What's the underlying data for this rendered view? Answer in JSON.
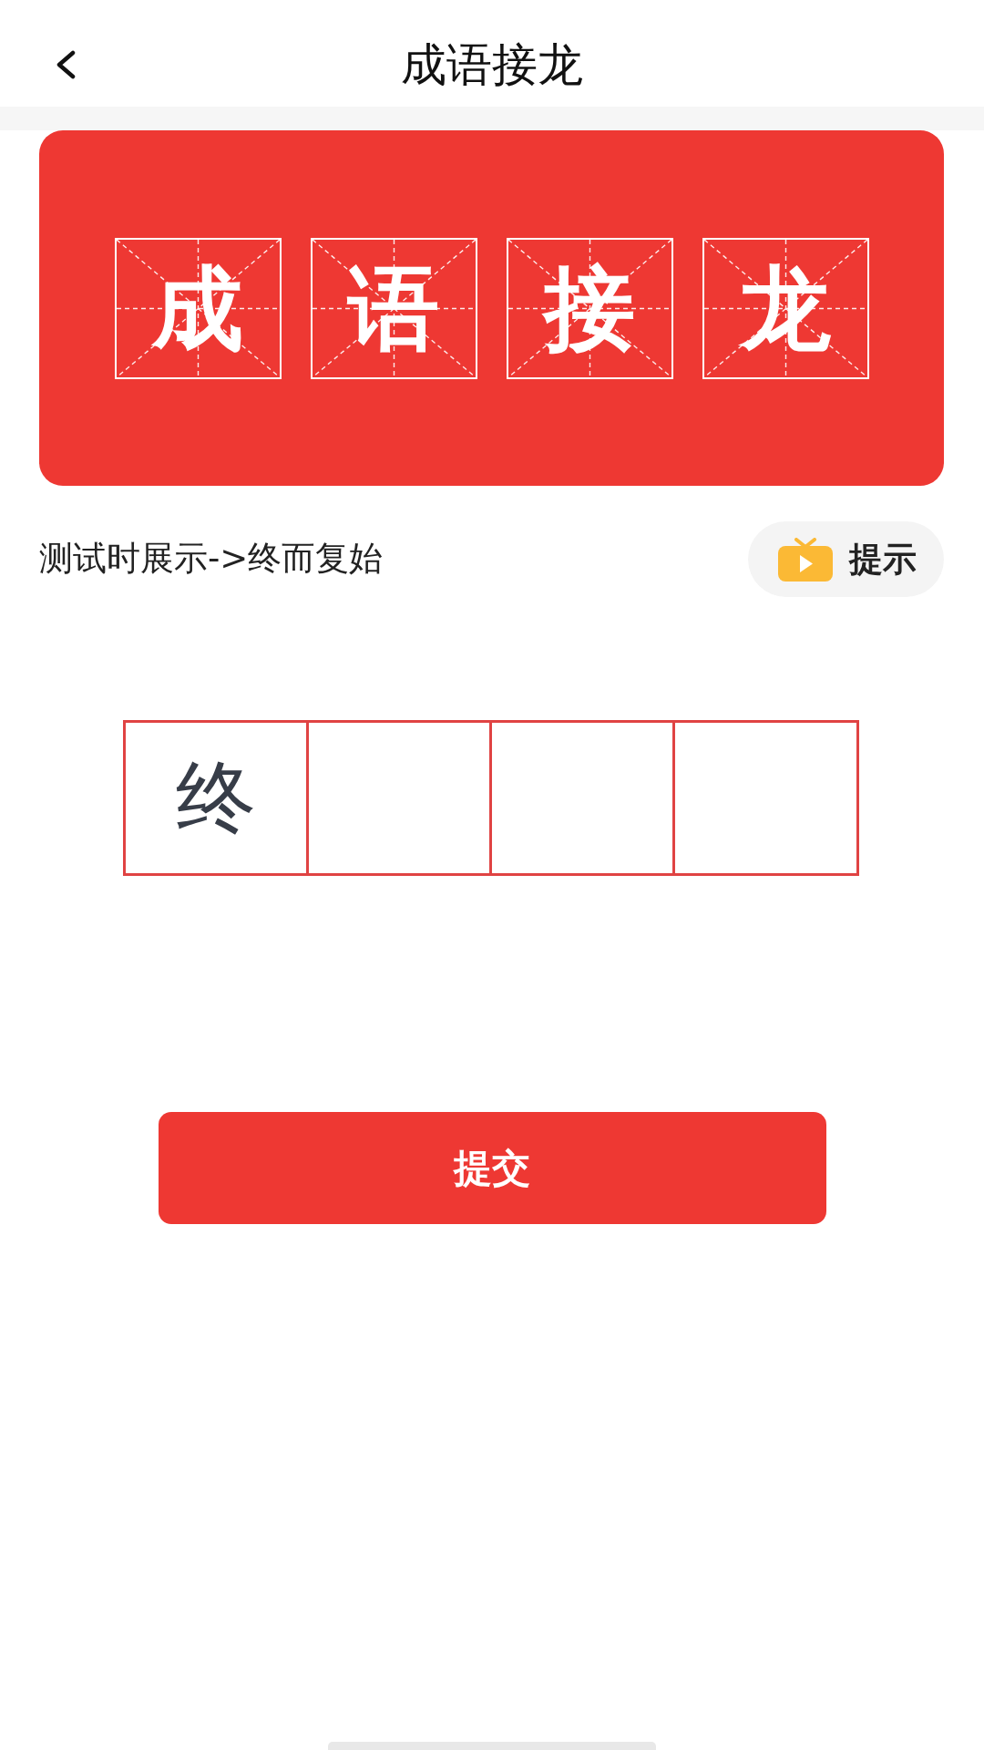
{
  "header": {
    "title": "成语接龙"
  },
  "banner": {
    "characters": [
      "成",
      "语",
      "接",
      "龙"
    ]
  },
  "hint_row": {
    "text": "测试时展示->终而复始",
    "hint_button": {
      "label": "提示"
    }
  },
  "answer_boxes": [
    {
      "kind": "given",
      "value": "终"
    },
    {
      "kind": "blank"
    },
    {
      "kind": "blank"
    },
    {
      "kind": "blank"
    }
  ],
  "submit_button": {
    "label": "提交"
  }
}
